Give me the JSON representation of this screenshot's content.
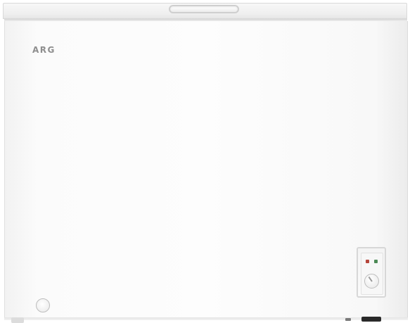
{
  "product": {
    "brand": "ARG"
  },
  "colors": {
    "body": "#fdfdfd",
    "lid": "#efefef",
    "brand_text": "#8e8e8e",
    "indicator_red": "#b5453b",
    "indicator_green": "#4c8a56",
    "foot_dark": "#2a2a2a"
  },
  "icons": {
    "handle": "lid-handle-icon",
    "knob": "thermostat-knob-icon",
    "drain": "drain-plug-icon"
  }
}
